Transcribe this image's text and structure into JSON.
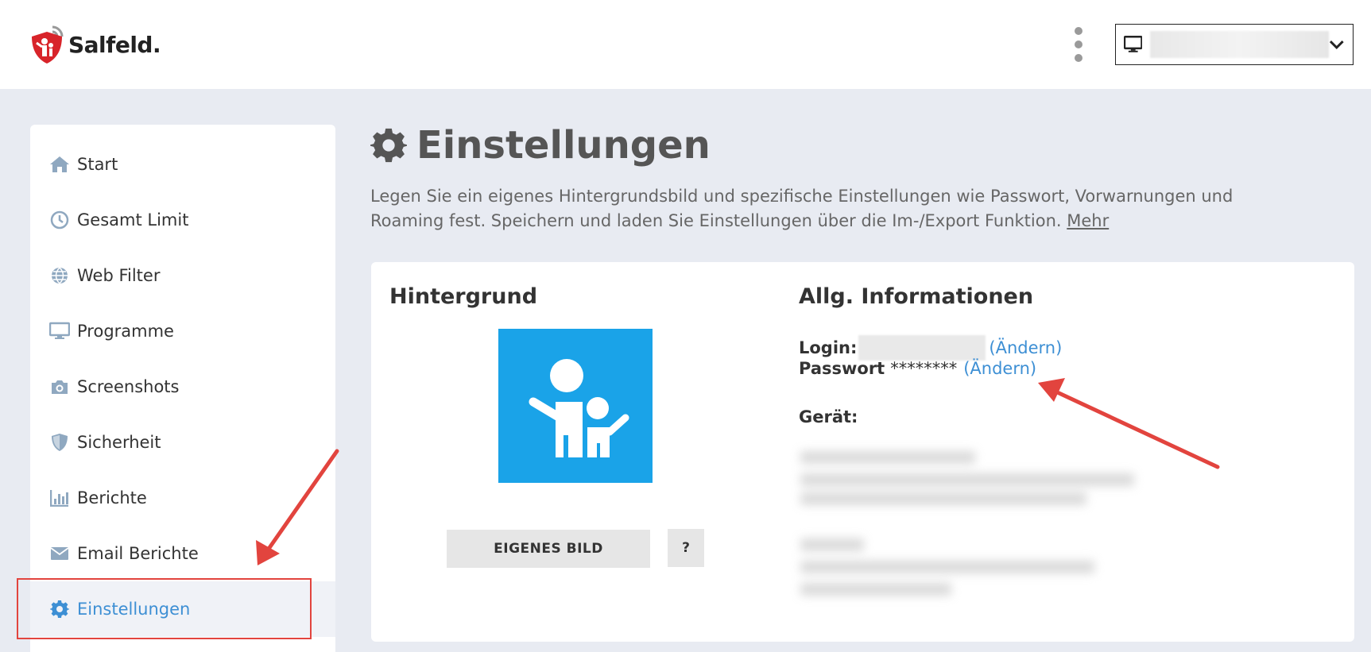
{
  "header": {
    "logo_text": "Salfeld.",
    "menu_icon": "kebab-icon",
    "device_selector": {
      "icon": "monitor-icon",
      "value": "",
      "chevron": "chevron-down-icon"
    }
  },
  "sidebar": {
    "items": [
      {
        "label": "Start",
        "icon": "home-icon"
      },
      {
        "label": "Gesamt Limit",
        "icon": "clock-icon"
      },
      {
        "label": "Web Filter",
        "icon": "globe-icon"
      },
      {
        "label": "Programme",
        "icon": "monitor-icon"
      },
      {
        "label": "Screenshots",
        "icon": "camera-icon"
      },
      {
        "label": "Sicherheit",
        "icon": "shield-icon"
      },
      {
        "label": "Berichte",
        "icon": "bar-chart-icon"
      },
      {
        "label": "Email Berichte",
        "icon": "envelope-icon"
      },
      {
        "label": "Einstellungen",
        "icon": "gear-icon",
        "active": true
      }
    ]
  },
  "main": {
    "title": "Einstellungen",
    "description": "Legen Sie ein eigenes Hintergrundsbild und spezifische Einstellungen wie Passwort, Vorwarnungen und Roaming fest. Speichern und laden Sie Einstellungen über die Im-/Export Funktion.",
    "more_link": "Mehr",
    "background_section": {
      "heading": "Hintergrund",
      "own_image_button": "EIGENES BILD",
      "help_button": "?"
    },
    "info_section": {
      "heading": "Allg. Informationen",
      "login_label": "Login:",
      "login_value": "",
      "login_change": "(Ändern)",
      "password_label": "Passwort",
      "password_value": "********",
      "password_change": "(Ändern)",
      "device_label": "Gerät:"
    }
  },
  "colors": {
    "accent": "#3d8fd4",
    "page_bg": "#e8ebf2",
    "tile_bg": "#1aa3e8",
    "annotation": "#e2443e"
  }
}
